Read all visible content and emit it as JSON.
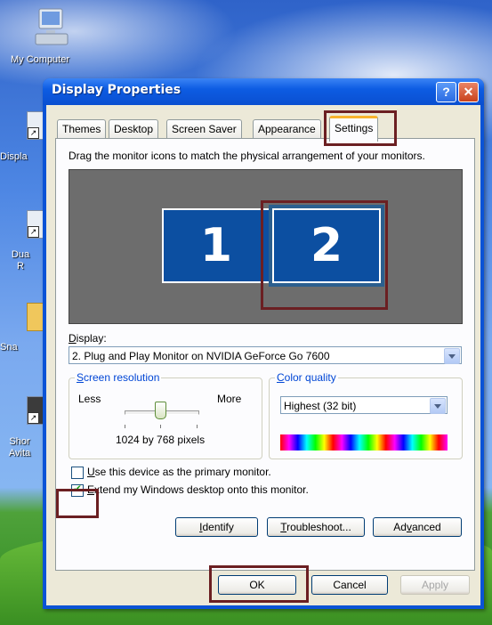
{
  "desktop": {
    "icons": [
      {
        "label": "My Computer"
      },
      {
        "label": "Displa"
      },
      {
        "label": "Dua\nR"
      },
      {
        "label": "Sna"
      },
      {
        "label": "Shor\nAvita"
      }
    ]
  },
  "window": {
    "title": "Display Properties",
    "help_button": "?",
    "close_button": "✕"
  },
  "tabs": [
    "Themes",
    "Desktop",
    "Screen Saver",
    "Appearance",
    "Settings"
  ],
  "active_tab": "Settings",
  "settings": {
    "instruction": "Drag the monitor icons to match the physical arrangement of your monitors.",
    "monitors": [
      "1",
      "2"
    ],
    "selected_monitor": "2",
    "display_label": "Display:",
    "display_value": "2. Plug and Play Monitor on NVIDIA GeForce Go 7600",
    "resolution": {
      "group_title": "Screen resolution",
      "less": "Less",
      "more": "More",
      "value_text": "1024 by 768 pixels"
    },
    "color_quality": {
      "group_title": "Color quality",
      "value": "Highest (32 bit)"
    },
    "primary_checkbox": {
      "label": "Use this device as the primary monitor.",
      "checked": false
    },
    "extend_checkbox": {
      "label": "Extend my Windows desktop onto this monitor.",
      "checked": true
    },
    "buttons": {
      "identify": "Identify",
      "troubleshoot": "Troubleshoot...",
      "advanced": "Advanced"
    }
  },
  "footer": {
    "ok": "OK",
    "cancel": "Cancel",
    "apply": "Apply"
  },
  "colors": {
    "monitor_blue": "#0c4fa1",
    "title_blue": "#0a53d6",
    "highlight": "#6b1f22",
    "tab_accent": "#f8b32d"
  }
}
